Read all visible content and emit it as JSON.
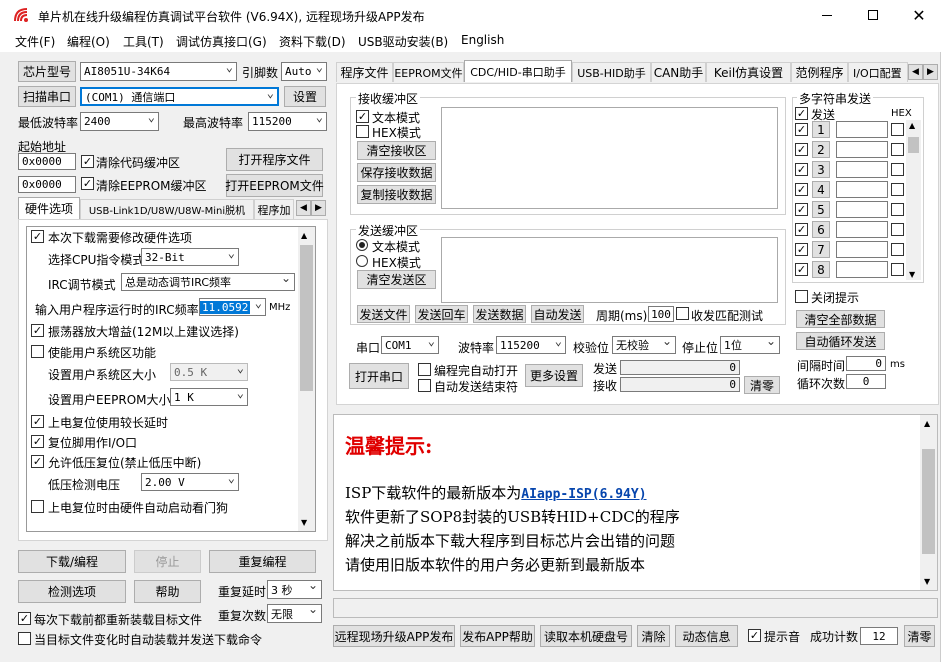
{
  "window": {
    "title": "单片机在线升级编程仿真调试平台软件 (V6.94X), 远程现场升级APP发布"
  },
  "menu": [
    "文件(F)",
    "编程(O)",
    "工具(T)",
    "调试仿真接口(G)",
    "资料下载(D)",
    "USB驱动安装(B)",
    "English"
  ],
  "left": {
    "chip_label": "芯片型号",
    "chip_value": "AI8051U-34K64",
    "pins_label": "引脚数",
    "pins_value": "Auto",
    "scan_label": "扫描串口",
    "port_value": "(COM1) 通信端口",
    "settings_label": "设置",
    "min_baud_label": "最低波特率",
    "min_baud_value": "2400",
    "max_baud_label": "最高波特率",
    "max_baud_value": "115200",
    "start_addr_label": "起始地址",
    "addr1": "0x0000",
    "clear_code": "清除代码缓冲区",
    "open_prog": "打开程序文件",
    "addr2": "0x0000",
    "clear_eeprom": "清除EEPROM缓冲区",
    "open_eeprom": "打开EEPROM文件",
    "tabs": [
      "硬件选项",
      "USB-Link1D/U8W/U8W-Mini脱机",
      "程序加"
    ],
    "hw": {
      "need_modify": "本次下载需要修改硬件选项",
      "cpu_mode_label": "选择CPU指令模式",
      "cpu_mode_value": "32-Bit",
      "irc_mode_label": "IRC调节模式",
      "irc_mode_value": "总是动态调节IRC频率",
      "freq_label": "输入用户程序运行时的IRC频率",
      "freq_value": "11.0592",
      "freq_unit": "MHz",
      "osc_gain": "振荡器放大增益(12M以上建议选择)",
      "user_sys": "使能用户系统区功能",
      "sys_size_label": "设置用户系统区大小",
      "sys_size_value": "0.5 K",
      "eeprom_size_label": "设置用户EEPROM大小",
      "eeprom_size_value": "1   K",
      "power_reset": "上电复位使用较长延时",
      "reset_pin": "复位脚用作I/O口",
      "lvr": "允许低压复位(禁止低压中断)",
      "lv_label": "低压检测电压",
      "lv_value": "2.00 V",
      "wdt": "上电复位时由硬件自动启动看门狗"
    },
    "download": "下载/编程",
    "stop": "停止",
    "repeat_prog": "重复编程",
    "check_opts": "检测选项",
    "help": "帮助",
    "repeat_delay_label": "重复延时",
    "repeat_delay_value": "3 秒",
    "repeat_count_label": "重复次数",
    "repeat_count_value": "无限",
    "reload_each": "每次下载前都重新装载目标文件",
    "auto_reload": "当目标文件变化时自动装载并发送下载命令"
  },
  "right": {
    "tabs": [
      "程序文件",
      "EEPROM文件",
      "CDC/HID-串口助手",
      "USB-HID助手",
      "CAN助手",
      "Keil仿真设置",
      "范例程序",
      "I/O口配置"
    ],
    "rx_group": "接收缓冲区",
    "text_mode": "文本模式",
    "hex_mode": "HEX模式",
    "clear_rx": "清空接收区",
    "save_rx": "保存接收数据",
    "copy_rx": "复制接收数据",
    "tx_group": "发送缓冲区",
    "clear_tx": "清空发送区",
    "send_file": "发送文件",
    "send_back": "发送回车",
    "send_data": "发送数据",
    "auto_send": "自动发送",
    "period_label": "周期(ms)",
    "period_value": "100",
    "rx_match": "收发匹配测试",
    "port_label": "串口",
    "port_value": "COM1",
    "baud_label": "波特率",
    "baud_value": "115200",
    "parity_label": "校验位",
    "parity_value": "无校验",
    "stop_label": "停止位",
    "stop_value": "1位",
    "open_port": "打开串口",
    "auto_open": "编程完自动打开",
    "auto_send_end": "自动发送结束符",
    "more_settings": "更多设置",
    "send_label": "发送",
    "send_count": "0",
    "recv_label": "接收",
    "recv_count": "0",
    "clear_counts": "清零",
    "multi_group": "多字符串发送",
    "multi_send": "发送",
    "multi_hex": "HEX",
    "multi_rows": [
      "1",
      "2",
      "3",
      "4",
      "5",
      "6",
      "7",
      "8"
    ],
    "close_tip": "关闭提示",
    "clear_all": "清空全部数据",
    "auto_loop": "自动循环发送",
    "interval_label": "间隔时间",
    "interval_value": "0",
    "interval_unit": "ms",
    "loop_label": "循环次数",
    "loop_value": "0"
  },
  "notice": {
    "title": "温馨提示:",
    "line1_prefix": "ISP下载软件的最新版本为",
    "line1_link": "AIapp-ISP(6.94Y)",
    "line2": "软件更新了SOP8封装的USB转HID+CDC的程序",
    "line3": "解决之前版本下载大程序到目标芯片会出错的问题",
    "line4": "请使用旧版本软件的用户务必更新到最新版本"
  },
  "bottom": {
    "remote_publish": "远程现场升级APP发布",
    "publish_help": "发布APP帮助",
    "read_serial": "读取本机硬盘号",
    "clear": "清除",
    "dynamic_info": "动态信息",
    "beep": "提示音",
    "success_label": "成功计数",
    "success_value": "12",
    "clear_count": "清零"
  },
  "colors": {
    "accent": "#0078d7",
    "link": "#0645ad",
    "notice_title": "#e00000"
  }
}
